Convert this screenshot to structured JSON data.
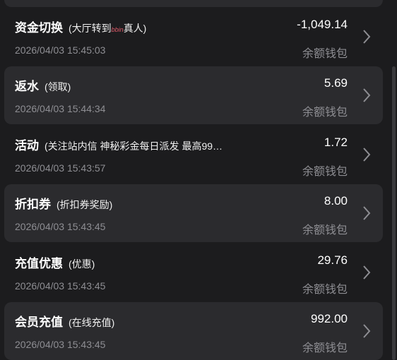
{
  "records": [
    {
      "title": "资金切换",
      "detail_prefix": "(大厅转到",
      "detail_brand": "bbin",
      "detail_suffix": "真人)",
      "amount": "-1,049.14",
      "wallet": "余额钱包",
      "time": "2026/04/03 15:45:03"
    },
    {
      "title": "返水",
      "detail": "(领取)",
      "amount": "5.69",
      "wallet": "余额钱包",
      "time": "2026/04/03 15:44:34"
    },
    {
      "title": "活动",
      "detail": "(关注站内信 神秘彩金每日派发 最高99…",
      "amount": "1.72",
      "wallet": "余额钱包",
      "time": "2026/04/03 15:43:57"
    },
    {
      "title": "折扣券",
      "detail": "(折扣券奖励)",
      "amount": "8.00",
      "wallet": "余额钱包",
      "time": "2026/04/03 15:43:45"
    },
    {
      "title": "充值优惠",
      "detail": "(优惠)",
      "amount": "29.76",
      "wallet": "余额钱包",
      "time": "2026/04/03 15:43:45"
    },
    {
      "title": "会员充值",
      "detail": "(在线充值)",
      "amount": "992.00",
      "wallet": "余额钱包",
      "time": "2026/04/03 15:43:45"
    }
  ],
  "icons": {
    "row_chevron": "chevron-right-icon"
  },
  "colors": {
    "background": "#1c1c1e",
    "card": "#2b2b2e",
    "secondary_text": "#8e8e93"
  }
}
